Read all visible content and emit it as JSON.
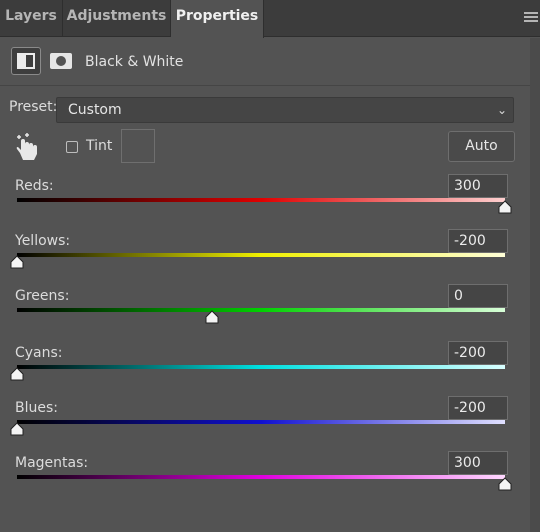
{
  "tabs": [
    {
      "label": "Layers",
      "active": false
    },
    {
      "label": "Adjustments",
      "active": false
    },
    {
      "label": "Properties",
      "active": true
    }
  ],
  "header": {
    "title": "Black & White"
  },
  "preset": {
    "label": "Preset:",
    "value": "Custom"
  },
  "tint": {
    "label": "Tint",
    "checked": false
  },
  "auto_label": "Auto",
  "slider_range": [
    -200,
    300
  ],
  "sliders": [
    {
      "label": "Reds:",
      "value": "300",
      "colors": [
        "#000000",
        "#e00000",
        "#ffd0d0"
      ]
    },
    {
      "label": "Yellows:",
      "value": "-200",
      "colors": [
        "#000000",
        "#f0f000",
        "#ffffd8"
      ]
    },
    {
      "label": "Greens:",
      "value": "0",
      "colors": [
        "#000000",
        "#00d000",
        "#d8ffd8"
      ]
    },
    {
      "label": "Cyans:",
      "value": "-200",
      "colors": [
        "#000000",
        "#00e0e0",
        "#d8ffff"
      ]
    },
    {
      "label": "Blues:",
      "value": "-200",
      "colors": [
        "#000000",
        "#1010d0",
        "#e0e0ff"
      ]
    },
    {
      "label": "Magentas:",
      "value": "300",
      "colors": [
        "#000000",
        "#e000e0",
        "#ffd8ff"
      ]
    }
  ]
}
